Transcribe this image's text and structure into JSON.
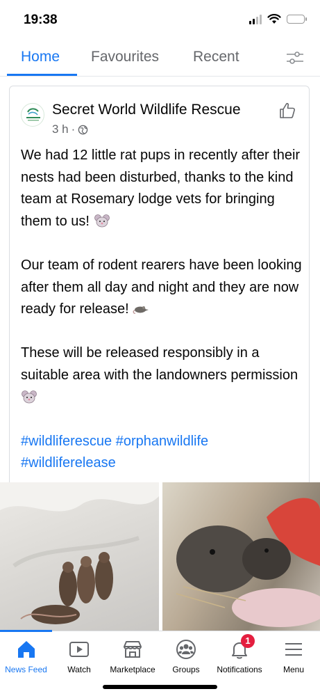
{
  "status": {
    "time": "19:38"
  },
  "tabs": [
    {
      "label": "Home",
      "active": true
    },
    {
      "label": "Favourites",
      "active": false
    },
    {
      "label": "Recent",
      "active": false
    }
  ],
  "post": {
    "page_name": "Secret World Wildlife Rescue",
    "time": "3 h",
    "separator": "·",
    "paragraphs": [
      "We had 12 little rat pups in recently after their nests had been disturbed, thanks to the kind team at Rosemary lodge vets for bringing them to us!",
      "Our team of rodent rearers have been looking after them all day and night and they are now ready for release!",
      "These will be released responsibly in a suitable area with the landowners permission"
    ],
    "hashtags": "#wildliferescue #orphanwildlife #wildliferelease"
  },
  "nav": [
    {
      "label": "News Feed",
      "icon": "home-icon",
      "active": true
    },
    {
      "label": "Watch",
      "icon": "watch-icon",
      "active": false
    },
    {
      "label": "Marketplace",
      "icon": "marketplace-icon",
      "active": false
    },
    {
      "label": "Groups",
      "icon": "groups-icon",
      "active": false
    },
    {
      "label": "Notifications",
      "icon": "bell-icon",
      "active": false,
      "badge": "1"
    },
    {
      "label": "Menu",
      "icon": "menu-icon",
      "active": false
    }
  ],
  "colors": {
    "accent": "#1877f2",
    "badge": "#e41e3f",
    "muted": "#65676b"
  }
}
